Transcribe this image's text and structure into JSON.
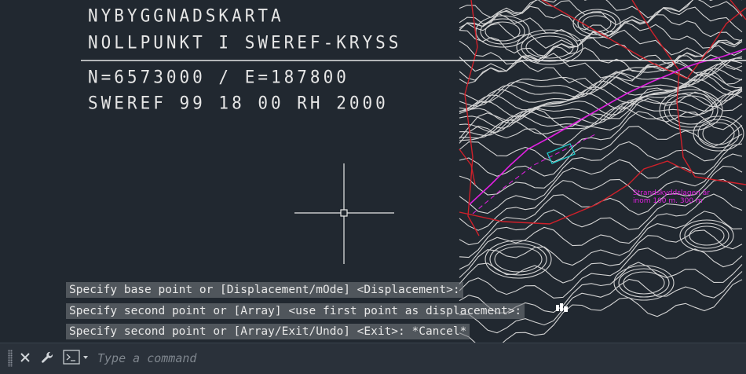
{
  "drawing": {
    "title_lines": [
      "NYBYGGNADSKARTA",
      "NOLLPUNKT I SWEREF-KRYSS"
    ],
    "coord_lines": [
      "N=6573000 / E=187800",
      "SWEREF 99 18 00 RH 2000"
    ],
    "map_labels": [
      "Strandskyddslagen är",
      "inom 100 m. 300 m"
    ]
  },
  "command_history": [
    "Specify base point or [Displacement/mOde] <Displacement>:",
    "Specify second point or [Array] <use first point as displacement>:",
    "Specify second point or [Array/Exit/Undo] <Exit>: *Cancel*"
  ],
  "command_line": {
    "placeholder": "Type a command"
  },
  "colors": {
    "background": "#212830",
    "contours": "#d8d8d8",
    "property_lines": "#d0202a",
    "road": "#e020e0",
    "building": "#20c8c8"
  }
}
